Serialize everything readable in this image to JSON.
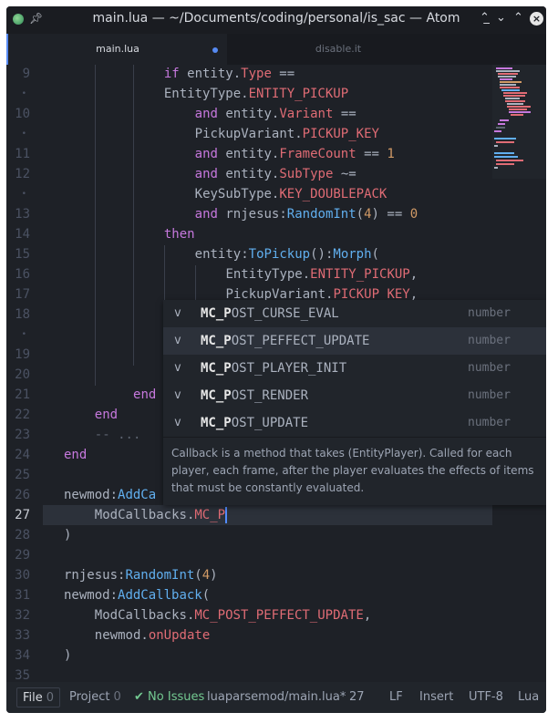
{
  "window": {
    "title": "main.lua — ~/Documents/coding/personal/is_sac — Atom",
    "app_icon": "atom-icon",
    "pin_icon": "pin-icon"
  },
  "tabs": [
    {
      "label": "main.lua",
      "active": true,
      "modified": true
    },
    {
      "label": "disable.it",
      "active": false
    }
  ],
  "editor": {
    "line_numbers": [
      "9",
      "•",
      "10",
      "•",
      "11",
      "12",
      "•",
      "13",
      "14",
      "15",
      "16",
      "17",
      "18",
      "•",
      "19",
      "20",
      "21",
      "22",
      "23",
      "24",
      "25",
      "26",
      "27",
      "28",
      "29",
      "30",
      "31",
      "32",
      "33",
      "34",
      "35"
    ],
    "current_line": "27",
    "lines": [
      [
        [
          "kw",
          "if "
        ],
        [
          "",
          "entity."
        ],
        [
          "red",
          "Type"
        ],
        [
          "",
          " =="
        ]
      ],
      [
        [
          "",
          "EntityType."
        ],
        [
          "red",
          "ENTITY_PICKUP"
        ]
      ],
      [
        [
          "kw",
          "and "
        ],
        [
          "",
          "entity."
        ],
        [
          "red",
          "Variant"
        ],
        [
          "",
          " =="
        ]
      ],
      [
        [
          "",
          "PickupVariant."
        ],
        [
          "red",
          "PICKUP_KEY"
        ]
      ],
      [
        [
          "kw",
          "and "
        ],
        [
          "",
          "entity."
        ],
        [
          "red",
          "FrameCount"
        ],
        [
          "",
          " == "
        ],
        [
          "num",
          "1"
        ]
      ],
      [
        [
          "kw",
          "and "
        ],
        [
          "",
          "entity."
        ],
        [
          "red",
          "SubType"
        ],
        [
          "",
          " ~="
        ]
      ],
      [
        [
          "",
          "KeySubType."
        ],
        [
          "red",
          "KEY_DOUBLEPACK"
        ]
      ],
      [
        [
          "kw",
          "and "
        ],
        [
          "",
          "rnjesus:"
        ],
        [
          "fn",
          "RandomInt"
        ],
        [
          "",
          "("
        ],
        [
          "num",
          "4"
        ],
        [
          "",
          ") == "
        ],
        [
          "num",
          "0"
        ]
      ],
      [
        [
          "kw",
          "then"
        ]
      ],
      [
        [
          "",
          "entity:"
        ],
        [
          "fn",
          "ToPickup"
        ],
        [
          "",
          "():"
        ],
        [
          "fn",
          "Morph"
        ],
        [
          "",
          "("
        ]
      ],
      [
        [
          "",
          "EntityType."
        ],
        [
          "red",
          "ENTITY_PICKUP"
        ],
        [
          "",
          ","
        ]
      ],
      [
        [
          "",
          "PickupVariant."
        ],
        [
          "red",
          "PICKUP_KEY"
        ],
        [
          "",
          ","
        ]
      ],
      [
        [
          "kw",
          "end"
        ]
      ],
      [
        [
          "kw",
          "end"
        ]
      ],
      [
        [
          "cm",
          "-- ..."
        ]
      ],
      [
        [
          "kw",
          "end"
        ]
      ],
      [
        [
          "",
          "newmod:"
        ],
        [
          "fn",
          "AddCa"
        ]
      ],
      [
        [
          "",
          "ModCallbacks."
        ],
        [
          "red",
          "MC_P"
        ]
      ],
      [
        [
          "",
          ")"
        ]
      ],
      [
        [
          "",
          "rnjesus:"
        ],
        [
          "fn",
          "RandomInt"
        ],
        [
          "",
          "("
        ],
        [
          "num",
          "4"
        ],
        [
          "",
          ")"
        ]
      ],
      [
        [
          "",
          "newmod:"
        ],
        [
          "fn",
          "AddCallback"
        ],
        [
          "",
          "("
        ]
      ],
      [
        [
          "",
          "ModCallbacks."
        ],
        [
          "red",
          "MC_POST_PEFFECT_UPDATE"
        ],
        [
          "",
          ","
        ]
      ],
      [
        [
          "",
          "newmod."
        ],
        [
          "red",
          "onUpdate"
        ]
      ],
      [
        [
          "",
          ")"
        ]
      ]
    ]
  },
  "autocomplete": {
    "items": [
      {
        "type": "v",
        "match": "MC_P",
        "rest": "OST_CURSE_EVAL",
        "right": "number",
        "selected": false
      },
      {
        "type": "v",
        "match": "MC_P",
        "rest": "OST_PEFFECT_UPDATE",
        "right": "number",
        "selected": true
      },
      {
        "type": "v",
        "match": "MC_P",
        "rest": "OST_PLAYER_INIT",
        "right": "number",
        "selected": false
      },
      {
        "type": "v",
        "match": "MC_P",
        "rest": "OST_RENDER",
        "right": "number",
        "selected": false
      },
      {
        "type": "v",
        "match": "MC_P",
        "rest": "OST_UPDATE",
        "right": "number",
        "selected": false
      }
    ],
    "description": "Callback is a method that takes (EntityPlayer). Called for each player, each frame, after the player evaluates the effects of items that must be constantly evaluated."
  },
  "statusbar": {
    "file_label": "File",
    "file_count": "0",
    "project_label": "Project",
    "project_count": "0",
    "issues": "No Issues",
    "path": "luaparsemod/main.lua*",
    "line": "27",
    "line_ending": "LF",
    "mode": "Insert",
    "encoding": "UTF-8",
    "grammar": "Lua"
  },
  "colors": {
    "keyword": "#c678dd",
    "function": "#61afef",
    "property": "#e06c75",
    "number": "#d19a66",
    "comment": "#5c6370",
    "accent": "#568af2"
  }
}
